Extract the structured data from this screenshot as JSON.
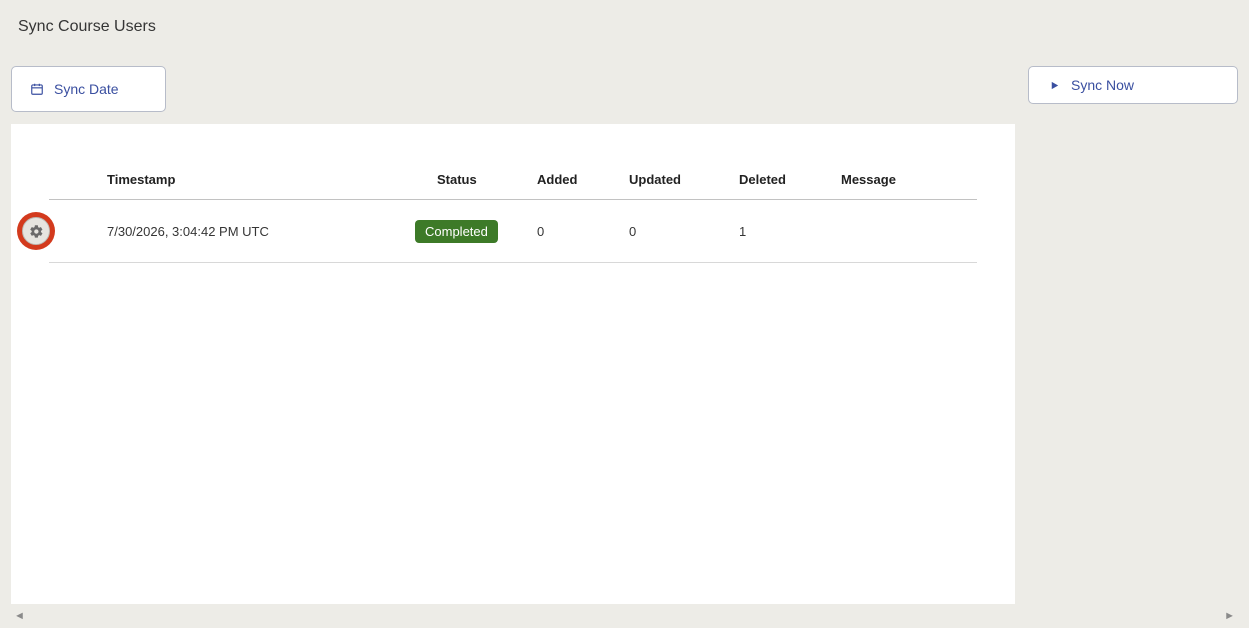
{
  "page": {
    "title": "Sync Course Users"
  },
  "toolbar": {
    "sync_date_label": "Sync Date",
    "sync_now_label": "Sync Now"
  },
  "table": {
    "headers": {
      "timestamp": "Timestamp",
      "status": "Status",
      "added": "Added",
      "updated": "Updated",
      "deleted": "Deleted",
      "message": "Message"
    },
    "rows": [
      {
        "timestamp": "7/30/2026, 3:04:42 PM UTC",
        "status": "Completed",
        "added": "0",
        "updated": "0",
        "deleted": "1",
        "message": ""
      }
    ]
  },
  "colors": {
    "primary": "#3a4fa0",
    "status_complete_bg": "#3d7a28",
    "gear_badge_bg": "#d33a1d"
  }
}
